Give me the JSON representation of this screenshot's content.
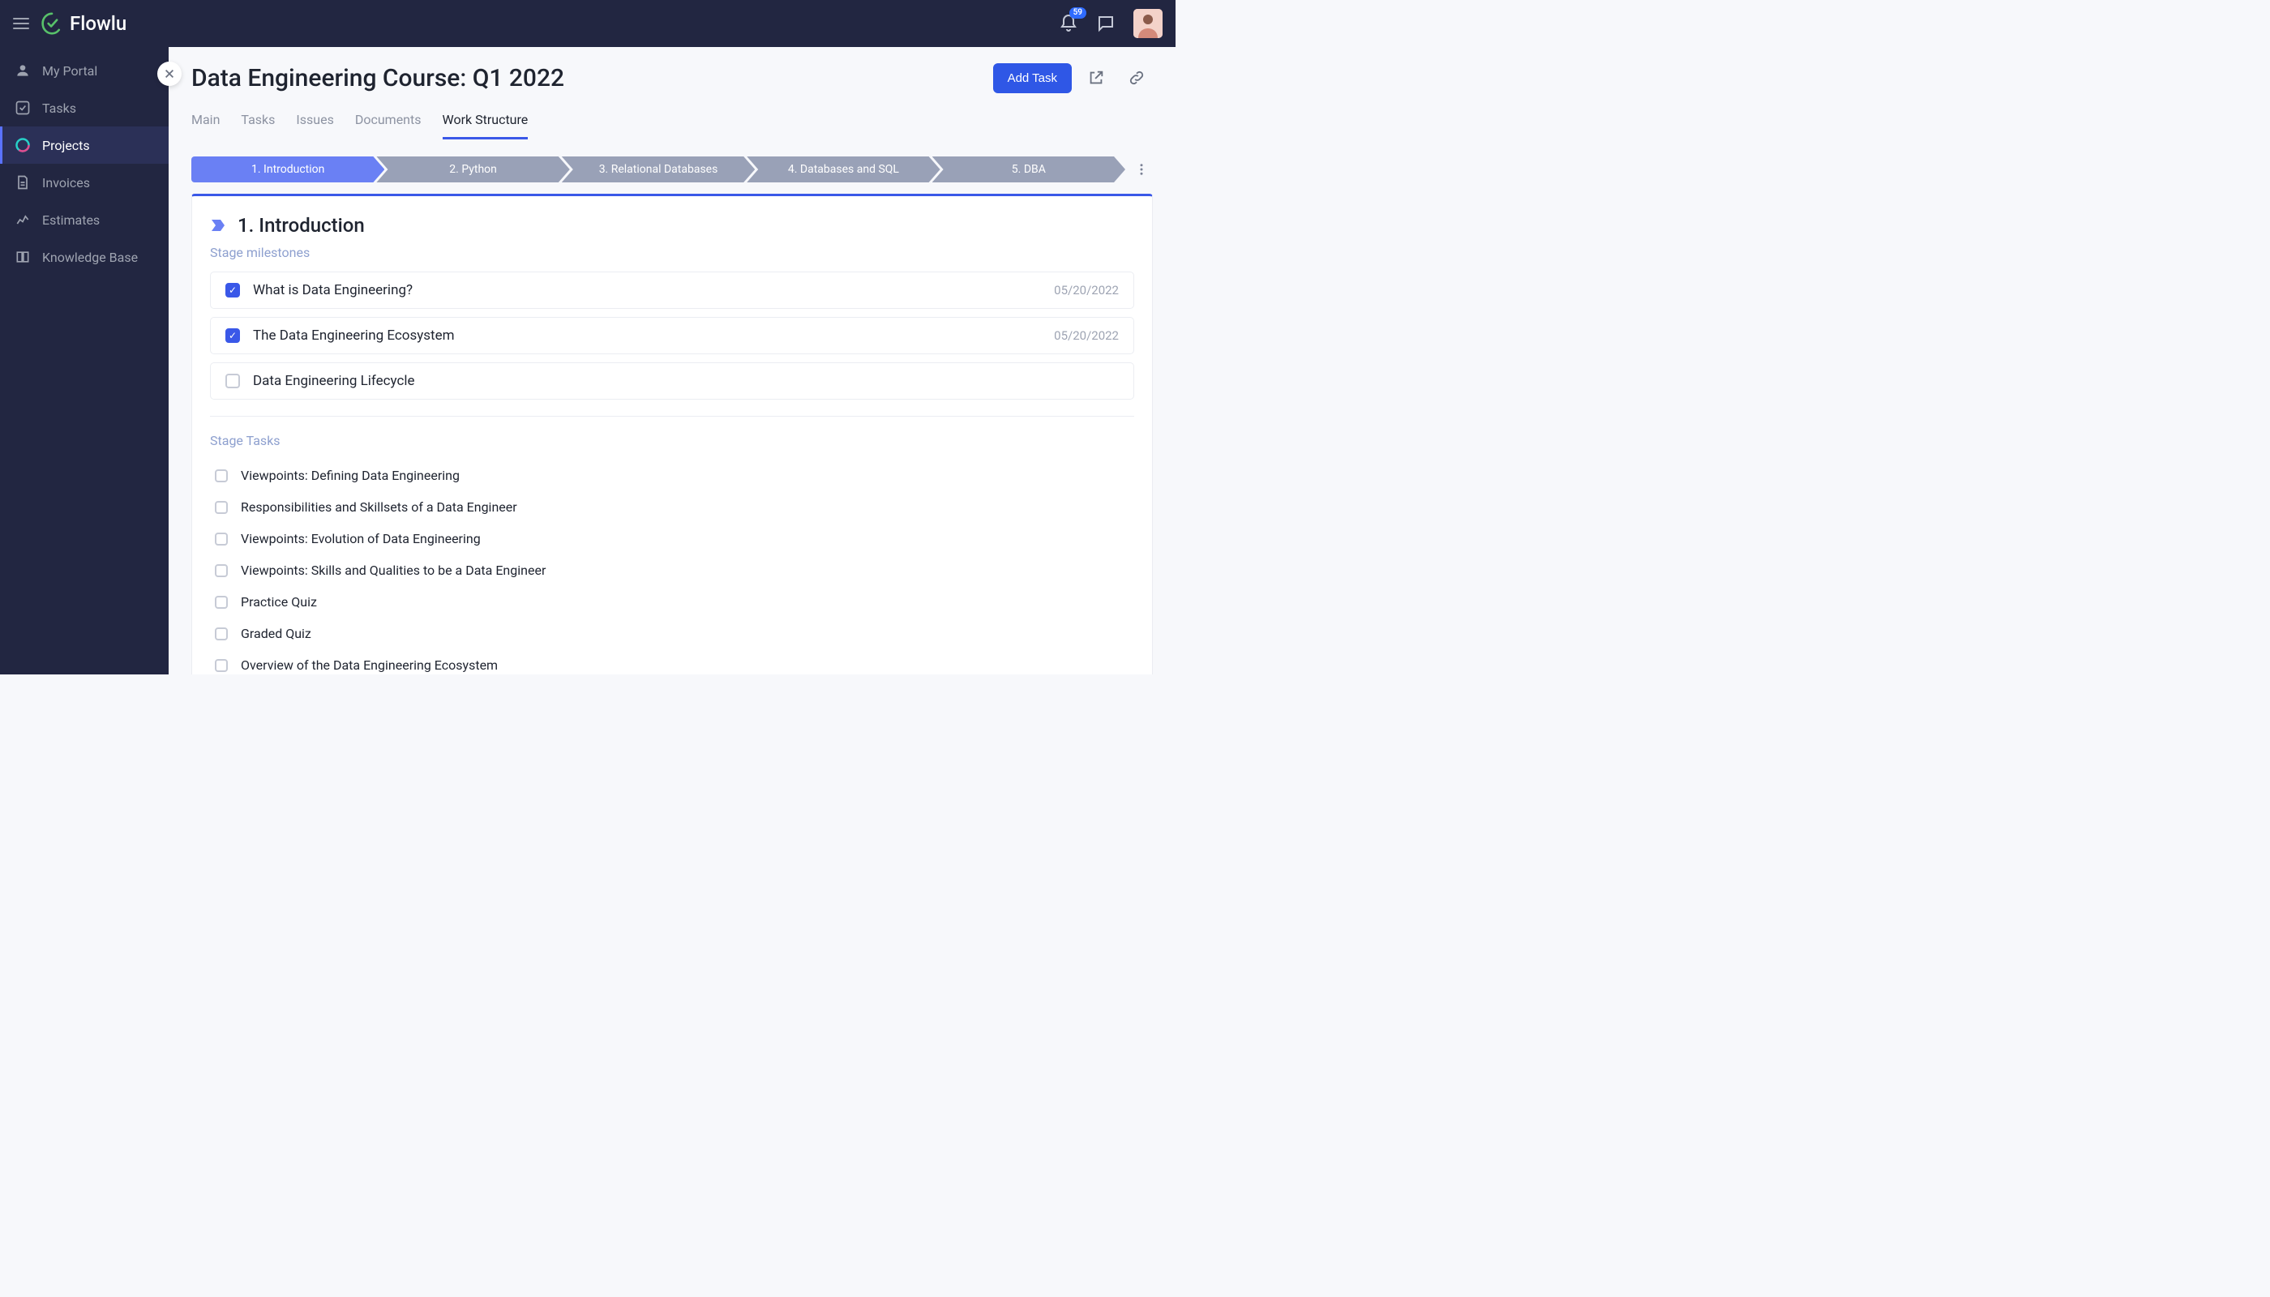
{
  "brand": {
    "name": "Flowlu"
  },
  "notifications": {
    "count": "59"
  },
  "sidebar": {
    "items": [
      {
        "label": "My Portal"
      },
      {
        "label": "Tasks"
      },
      {
        "label": "Projects"
      },
      {
        "label": "Invoices"
      },
      {
        "label": "Estimates"
      },
      {
        "label": "Knowledge Base"
      }
    ]
  },
  "page": {
    "title": "Data Engineering Course: Q1 2022",
    "add_task_label": "Add Task"
  },
  "tabs": [
    {
      "label": "Main"
    },
    {
      "label": "Tasks"
    },
    {
      "label": "Issues"
    },
    {
      "label": "Documents"
    },
    {
      "label": "Work Structure"
    }
  ],
  "stages": [
    {
      "label": "1. Introduction"
    },
    {
      "label": "2. Python"
    },
    {
      "label": "3. Relational Databases"
    },
    {
      "label": "4. Databases and SQL"
    },
    {
      "label": "5. DBA"
    }
  ],
  "stage_panel": {
    "title": "1. Introduction",
    "milestones_label": "Stage milestones",
    "milestones": [
      {
        "label": "What is Data Engineering?",
        "date": "05/20/2022",
        "checked": true
      },
      {
        "label": "The Data Engineering Ecosystem",
        "date": "05/20/2022",
        "checked": true
      },
      {
        "label": "Data Engineering Lifecycle",
        "date": "",
        "checked": false
      }
    ],
    "tasks_label": "Stage Tasks",
    "tasks": [
      {
        "label": "Viewpoints: Defining Data Engineering"
      },
      {
        "label": "Responsibilities and Skillsets of a Data Engineer"
      },
      {
        "label": "Viewpoints: Evolution of Data Engineering"
      },
      {
        "label": "Viewpoints: Skills and Qualities to be a Data Engineer"
      },
      {
        "label": "Practice Quiz"
      },
      {
        "label": "Graded Quiz"
      },
      {
        "label": "Overview of the Data Engineering Ecosystem"
      }
    ]
  }
}
